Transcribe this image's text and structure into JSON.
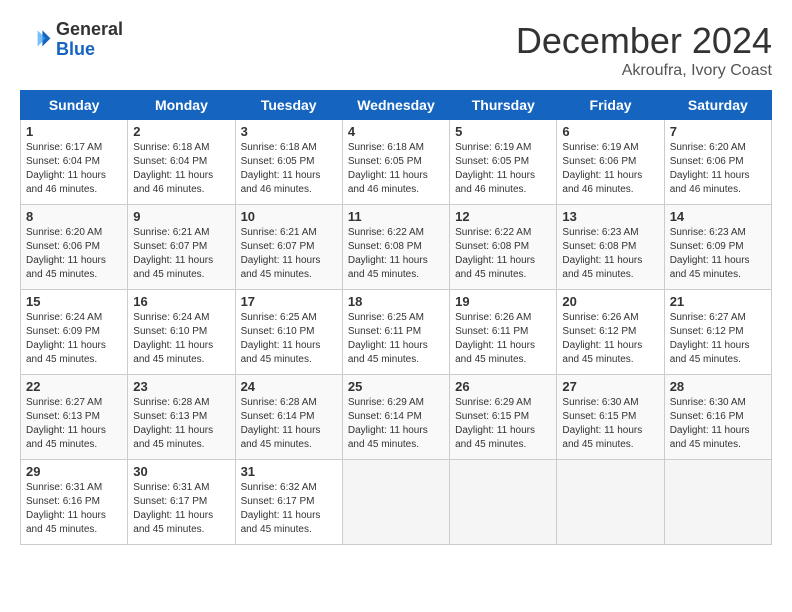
{
  "header": {
    "logo_line1": "General",
    "logo_line2": "Blue",
    "month_title": "December 2024",
    "subtitle": "Akroufra, Ivory Coast"
  },
  "days_of_week": [
    "Sunday",
    "Monday",
    "Tuesday",
    "Wednesday",
    "Thursday",
    "Friday",
    "Saturday"
  ],
  "weeks": [
    [
      {
        "day": "1",
        "sunrise": "6:17 AM",
        "sunset": "6:04 PM",
        "daylight": "11 hours and 46 minutes."
      },
      {
        "day": "2",
        "sunrise": "6:18 AM",
        "sunset": "6:04 PM",
        "daylight": "11 hours and 46 minutes."
      },
      {
        "day": "3",
        "sunrise": "6:18 AM",
        "sunset": "6:05 PM",
        "daylight": "11 hours and 46 minutes."
      },
      {
        "day": "4",
        "sunrise": "6:18 AM",
        "sunset": "6:05 PM",
        "daylight": "11 hours and 46 minutes."
      },
      {
        "day": "5",
        "sunrise": "6:19 AM",
        "sunset": "6:05 PM",
        "daylight": "11 hours and 46 minutes."
      },
      {
        "day": "6",
        "sunrise": "6:19 AM",
        "sunset": "6:06 PM",
        "daylight": "11 hours and 46 minutes."
      },
      {
        "day": "7",
        "sunrise": "6:20 AM",
        "sunset": "6:06 PM",
        "daylight": "11 hours and 46 minutes."
      }
    ],
    [
      {
        "day": "8",
        "sunrise": "6:20 AM",
        "sunset": "6:06 PM",
        "daylight": "11 hours and 45 minutes."
      },
      {
        "day": "9",
        "sunrise": "6:21 AM",
        "sunset": "6:07 PM",
        "daylight": "11 hours and 45 minutes."
      },
      {
        "day": "10",
        "sunrise": "6:21 AM",
        "sunset": "6:07 PM",
        "daylight": "11 hours and 45 minutes."
      },
      {
        "day": "11",
        "sunrise": "6:22 AM",
        "sunset": "6:08 PM",
        "daylight": "11 hours and 45 minutes."
      },
      {
        "day": "12",
        "sunrise": "6:22 AM",
        "sunset": "6:08 PM",
        "daylight": "11 hours and 45 minutes."
      },
      {
        "day": "13",
        "sunrise": "6:23 AM",
        "sunset": "6:08 PM",
        "daylight": "11 hours and 45 minutes."
      },
      {
        "day": "14",
        "sunrise": "6:23 AM",
        "sunset": "6:09 PM",
        "daylight": "11 hours and 45 minutes."
      }
    ],
    [
      {
        "day": "15",
        "sunrise": "6:24 AM",
        "sunset": "6:09 PM",
        "daylight": "11 hours and 45 minutes."
      },
      {
        "day": "16",
        "sunrise": "6:24 AM",
        "sunset": "6:10 PM",
        "daylight": "11 hours and 45 minutes."
      },
      {
        "day": "17",
        "sunrise": "6:25 AM",
        "sunset": "6:10 PM",
        "daylight": "11 hours and 45 minutes."
      },
      {
        "day": "18",
        "sunrise": "6:25 AM",
        "sunset": "6:11 PM",
        "daylight": "11 hours and 45 minutes."
      },
      {
        "day": "19",
        "sunrise": "6:26 AM",
        "sunset": "6:11 PM",
        "daylight": "11 hours and 45 minutes."
      },
      {
        "day": "20",
        "sunrise": "6:26 AM",
        "sunset": "6:12 PM",
        "daylight": "11 hours and 45 minutes."
      },
      {
        "day": "21",
        "sunrise": "6:27 AM",
        "sunset": "6:12 PM",
        "daylight": "11 hours and 45 minutes."
      }
    ],
    [
      {
        "day": "22",
        "sunrise": "6:27 AM",
        "sunset": "6:13 PM",
        "daylight": "11 hours and 45 minutes."
      },
      {
        "day": "23",
        "sunrise": "6:28 AM",
        "sunset": "6:13 PM",
        "daylight": "11 hours and 45 minutes."
      },
      {
        "day": "24",
        "sunrise": "6:28 AM",
        "sunset": "6:14 PM",
        "daylight": "11 hours and 45 minutes."
      },
      {
        "day": "25",
        "sunrise": "6:29 AM",
        "sunset": "6:14 PM",
        "daylight": "11 hours and 45 minutes."
      },
      {
        "day": "26",
        "sunrise": "6:29 AM",
        "sunset": "6:15 PM",
        "daylight": "11 hours and 45 minutes."
      },
      {
        "day": "27",
        "sunrise": "6:30 AM",
        "sunset": "6:15 PM",
        "daylight": "11 hours and 45 minutes."
      },
      {
        "day": "28",
        "sunrise": "6:30 AM",
        "sunset": "6:16 PM",
        "daylight": "11 hours and 45 minutes."
      }
    ],
    [
      {
        "day": "29",
        "sunrise": "6:31 AM",
        "sunset": "6:16 PM",
        "daylight": "11 hours and 45 minutes."
      },
      {
        "day": "30",
        "sunrise": "6:31 AM",
        "sunset": "6:17 PM",
        "daylight": "11 hours and 45 minutes."
      },
      {
        "day": "31",
        "sunrise": "6:32 AM",
        "sunset": "6:17 PM",
        "daylight": "11 hours and 45 minutes."
      },
      null,
      null,
      null,
      null
    ]
  ]
}
